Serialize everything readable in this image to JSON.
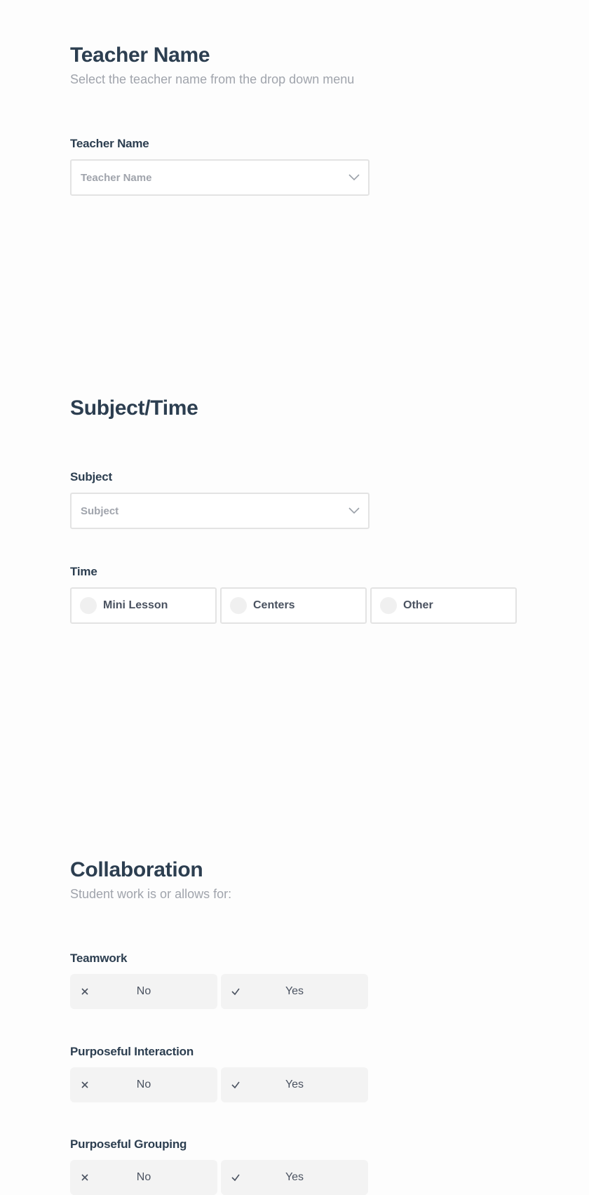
{
  "sections": {
    "teacher": {
      "title": "Teacher Name",
      "subtitle": "Select the teacher name from the drop down menu",
      "field_label": "Teacher Name",
      "select_placeholder": "Teacher Name"
    },
    "subject_time": {
      "title": "Subject/Time",
      "subject_label": "Subject",
      "subject_placeholder": "Subject",
      "time_label": "Time",
      "time_options": [
        "Mini Lesson",
        "Centers",
        "Other"
      ]
    },
    "collaboration": {
      "title": "Collaboration",
      "subtitle": "Student work is or allows for:",
      "questions": [
        {
          "label": "Teamwork",
          "no": "No",
          "yes": "Yes"
        },
        {
          "label": "Purposeful Interaction",
          "no": "No",
          "yes": "Yes"
        },
        {
          "label": "Purposeful Grouping",
          "no": "No",
          "yes": "Yes"
        }
      ]
    }
  },
  "icons": {
    "select": "chevron-down-icon",
    "radio": "radio-circle-icon",
    "no": "x-icon",
    "yes": "check-icon"
  }
}
